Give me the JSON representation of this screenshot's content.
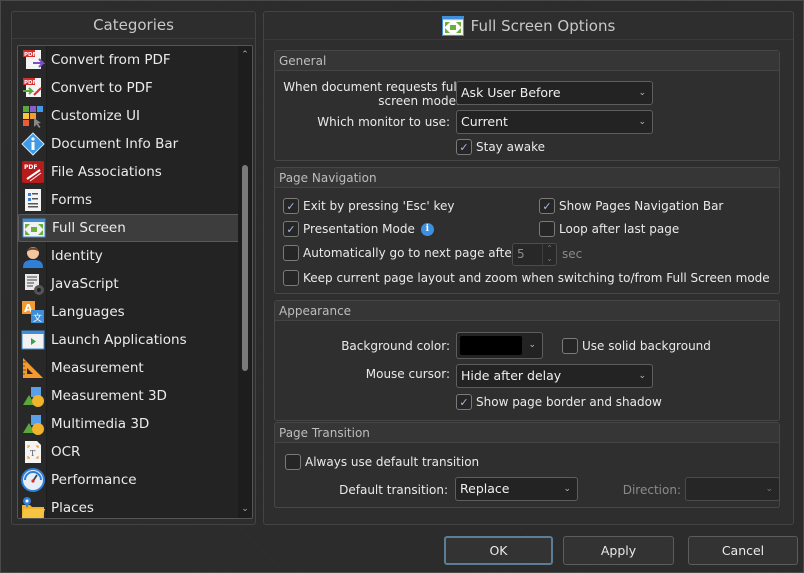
{
  "categories": {
    "title": "Categories",
    "items": [
      {
        "label": "Convert from PDF",
        "icon": "convert-from-pdf-icon",
        "selected": false
      },
      {
        "label": "Convert to PDF",
        "icon": "convert-to-pdf-icon",
        "selected": false
      },
      {
        "label": "Customize UI",
        "icon": "customize-ui-icon",
        "selected": false
      },
      {
        "label": "Document Info Bar",
        "icon": "info-icon",
        "selected": false
      },
      {
        "label": "File Associations",
        "icon": "file-associations-icon",
        "selected": false
      },
      {
        "label": "Forms",
        "icon": "forms-icon",
        "selected": false
      },
      {
        "label": "Full Screen",
        "icon": "full-screen-icon",
        "selected": true
      },
      {
        "label": "Identity",
        "icon": "identity-icon",
        "selected": false
      },
      {
        "label": "JavaScript",
        "icon": "javascript-icon",
        "selected": false
      },
      {
        "label": "Languages",
        "icon": "languages-icon",
        "selected": false
      },
      {
        "label": "Launch Applications",
        "icon": "launch-applications-icon",
        "selected": false
      },
      {
        "label": "Measurement",
        "icon": "measurement-icon",
        "selected": false
      },
      {
        "label": "Measurement 3D",
        "icon": "measurement-3d-icon",
        "selected": false
      },
      {
        "label": "Multimedia 3D",
        "icon": "multimedia-3d-icon",
        "selected": false
      },
      {
        "label": "OCR",
        "icon": "ocr-icon",
        "selected": false
      },
      {
        "label": "Performance",
        "icon": "performance-icon",
        "selected": false
      },
      {
        "label": "Places",
        "icon": "places-icon",
        "selected": false
      }
    ]
  },
  "options": {
    "title": "Full Screen Options",
    "general": {
      "heading": "General",
      "request_label_line1": "When document requests full",
      "request_label_line2": "screen mode:",
      "request_value": "Ask User Before",
      "monitor_label": "Which monitor to use:",
      "monitor_value": "Current",
      "stay_awake": {
        "label": "Stay awake",
        "checked": true
      }
    },
    "navigation": {
      "heading": "Page Navigation",
      "exit_esc": {
        "label": "Exit by pressing 'Esc' key",
        "checked": true
      },
      "show_nav_bar": {
        "label": "Show Pages Navigation Bar",
        "checked": true
      },
      "presentation_mode": {
        "label": "Presentation Mode",
        "checked": true
      },
      "loop": {
        "label": "Loop after last page",
        "checked": false
      },
      "auto_next": {
        "label": "Automatically go to next page after:",
        "checked": false
      },
      "auto_next_value": "5",
      "auto_next_unit": "sec",
      "keep_layout": {
        "label": "Keep current page layout and zoom when switching to/from Full Screen mode",
        "checked": false
      }
    },
    "appearance": {
      "heading": "Appearance",
      "bg_color_label": "Background color:",
      "bg_color_value": "#000000",
      "solid_bg": {
        "label": "Use solid background",
        "checked": false
      },
      "cursor_label": "Mouse cursor:",
      "cursor_value": "Hide after delay",
      "border_shadow": {
        "label": "Show page border and shadow",
        "checked": true
      }
    },
    "transition": {
      "heading": "Page Transition",
      "always_default": {
        "label": "Always use default transition",
        "checked": false
      },
      "default_label": "Default transition:",
      "default_value": "Replace",
      "direction_label": "Direction:",
      "direction_value": ""
    }
  },
  "buttons": {
    "ok": "OK",
    "apply": "Apply",
    "cancel": "Cancel"
  },
  "glyphs": {
    "check": "✓",
    "chevron_down": "⌄",
    "chevron_up": "⌃",
    "info": "i"
  }
}
